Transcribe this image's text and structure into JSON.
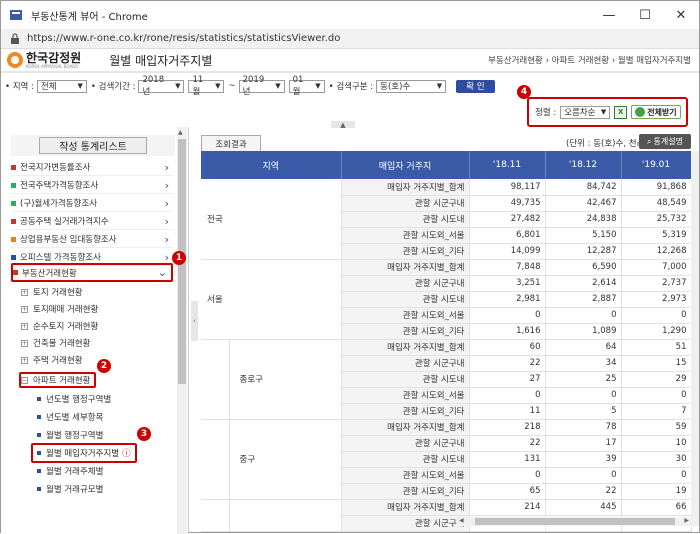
{
  "window": {
    "title": "부동산통계 뷰어 - Chrome",
    "url": "https://www.r-one.co.kr/rone/resis/statistics/statisticsViewer.do"
  },
  "header": {
    "logo_name": "한국감정원",
    "logo_sub": "KOREA APPRAISAL BOARD",
    "page_title": "월별 매입자거주지별",
    "breadcrumb": "부동산거래현황 › 아파트 거래현황 › 월별 매입자거주지별"
  },
  "filters": {
    "region_label": "• 지역 :",
    "region_value": "전체",
    "period_label": "• 검색기간 :",
    "start_year": "2018년",
    "start_month": "11월",
    "tilde": "~",
    "end_year": "2019년",
    "end_month": "01월",
    "search_label": "• 검색구분 :",
    "search_value": "동(호)수",
    "confirm": "확 인"
  },
  "toolbar": {
    "sort_label": "정렬 :",
    "sort_value": "오름차순",
    "excel": "X",
    "fullview": "전체받기"
  },
  "badges": {
    "b1": "1",
    "b2": "2",
    "b3": "3",
    "b4": "4"
  },
  "sidebar": {
    "header_button": "작성 통계리스트",
    "menu": [
      {
        "label": "전국지가변동률조사",
        "color": "#c0392b"
      },
      {
        "label": "전국주택가격동향조사",
        "color": "#27ae60"
      },
      {
        "label": "(구)월세가격동향조사",
        "color": "#27ae60"
      },
      {
        "label": "공동주택 실거래가격지수",
        "color": "#c0392b"
      },
      {
        "label": "상업용부동산 임대동향조사",
        "color": "#e67e22"
      },
      {
        "label": "오피스텔 가격동향조사",
        "color": "#2f4d9e"
      },
      {
        "label": "부동산거래현황",
        "color": "#c0392b"
      }
    ],
    "sub": [
      "토지 거래현황",
      "토지매매 거래현황",
      "순수토지 거래현황",
      "건축물 거래현황",
      "주택 거래현황",
      "아파트 거래현황"
    ],
    "leaves": [
      "년도별 행정구역별",
      "년도별 세부항목",
      "월별 행정구역별",
      "월별 매입자거주지별",
      "월별 거래주체별",
      "월별 거래규모별"
    ]
  },
  "result": {
    "tab": "조회결과",
    "unit": "(단위 : 동(호)수, 천㎡)",
    "explain": "통계설명",
    "columns": [
      "지역",
      "매입자 거주지",
      "'18.11",
      "'18.12",
      "'19.01"
    ],
    "groups": [
      {
        "region": "전국",
        "sub": "",
        "rows": [
          [
            "매입자 거주지별_합계",
            "98,117",
            "84,742",
            "91,868"
          ],
          [
            "관할 시군구내",
            "49,735",
            "42,467",
            "48,549"
          ],
          [
            "관할 시도내",
            "27,482",
            "24,838",
            "25,732"
          ],
          [
            "관할 시도외_서울",
            "6,801",
            "5,150",
            "5,319"
          ],
          [
            "관할 시도외_기타",
            "14,099",
            "12,287",
            "12,268"
          ]
        ]
      },
      {
        "region": "서울",
        "sub": "",
        "rows": [
          [
            "매입자 거주지별_합계",
            "7,848",
            "6,590",
            "7,000"
          ],
          [
            "관할 시군구내",
            "3,251",
            "2,614",
            "2,737"
          ],
          [
            "관할 시도내",
            "2,981",
            "2,887",
            "2,973"
          ],
          [
            "관할 시도외_서울",
            "0",
            "0",
            "0"
          ],
          [
            "관할 시도외_기타",
            "1,616",
            "1,089",
            "1,290"
          ]
        ]
      },
      {
        "region": "",
        "sub": "종로구",
        "rows": [
          [
            "매입자 거주지별_합계",
            "60",
            "64",
            "51"
          ],
          [
            "관할 시군구내",
            "22",
            "34",
            "15"
          ],
          [
            "관할 시도내",
            "27",
            "25",
            "29"
          ],
          [
            "관할 시도외_서울",
            "0",
            "0",
            "0"
          ],
          [
            "관할 시도외_기타",
            "11",
            "5",
            "7"
          ]
        ]
      },
      {
        "region": "",
        "sub": "중구",
        "rows": [
          [
            "매입자 거주지별_합계",
            "218",
            "78",
            "59"
          ],
          [
            "관할 시군구내",
            "22",
            "17",
            "10"
          ],
          [
            "관할 시도내",
            "131",
            "39",
            "30"
          ],
          [
            "관할 시도외_서울",
            "0",
            "0",
            "0"
          ],
          [
            "관할 시도외_기타",
            "65",
            "22",
            "19"
          ]
        ]
      },
      {
        "region": "",
        "sub": "",
        "rows": [
          [
            "매입자 거주지별_합계",
            "214",
            "445",
            "66"
          ],
          [
            "관할 시군구내",
            "",
            "",
            ""
          ]
        ]
      }
    ]
  }
}
